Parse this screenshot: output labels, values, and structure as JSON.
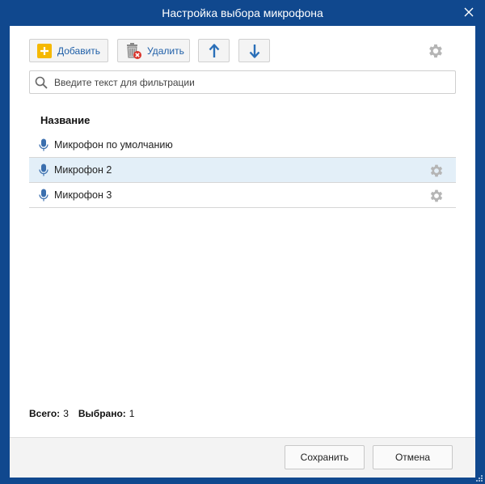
{
  "window": {
    "title": "Настройка выбора микрофона"
  },
  "toolbar": {
    "add_label": "Добавить",
    "delete_label": "Удалить"
  },
  "search": {
    "placeholder": "Введите текст для фильтрации",
    "value": ""
  },
  "list": {
    "column_header": "Название",
    "rows": [
      {
        "name": "Микрофон по умолчанию",
        "selected": false,
        "has_settings": false
      },
      {
        "name": "Микрофон 2",
        "selected": true,
        "has_settings": true
      },
      {
        "name": "Микрофон 3",
        "selected": false,
        "has_settings": true
      }
    ]
  },
  "status": {
    "total_label": "Всего:",
    "total_value": "3",
    "selected_label": "Выбрано:",
    "selected_value": "1"
  },
  "footer": {
    "save_label": "Сохранить",
    "cancel_label": "Отмена"
  },
  "colors": {
    "title_bar": "#10488e",
    "accent": "#1f5fa8",
    "selected_row": "#e3eff8",
    "add_icon": "#f5b800",
    "delete_badge": "#d9342b"
  }
}
